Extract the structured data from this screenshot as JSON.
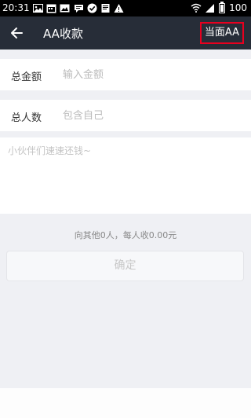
{
  "status_bar": {
    "time": "20:31",
    "notification_icons": [
      "photo-icon",
      "calendar-icon",
      "image-icon",
      "message-icon",
      "check-icon",
      "book-icon",
      "warning-icon"
    ],
    "battery": "100"
  },
  "nav": {
    "title": "AA收款",
    "action_label": "当面AA"
  },
  "form": {
    "total_amount": {
      "label": "总金额",
      "placeholder": "输入金额",
      "value": ""
    },
    "people_count": {
      "label": "总人数",
      "placeholder": "包含自己",
      "value": ""
    },
    "note": {
      "placeholder": "小伙伴们速速还钱~",
      "value": ""
    }
  },
  "summary_text": "向其他0人，每人收0.00元",
  "confirm_label": "确定",
  "colors": {
    "nav_bg": "#272d38",
    "highlight_border": "#e8001f",
    "page_bg": "#eff0f4"
  }
}
